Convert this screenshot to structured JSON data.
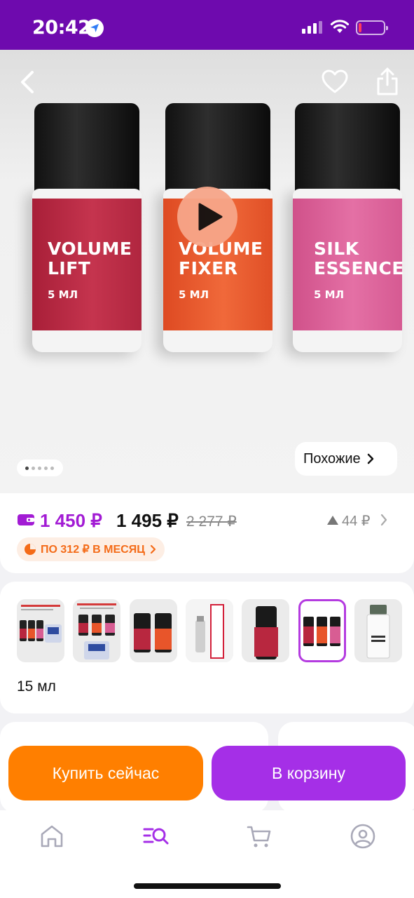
{
  "status_bar": {
    "time": "20:42",
    "battery_color": "#ff3b5c"
  },
  "hero": {
    "products": [
      {
        "line1": "VOLUME\nLIFT",
        "volume": "5 МЛ",
        "label_color": "#b8273f"
      },
      {
        "line1": "VOLUME\nFIXER",
        "volume": "5 МЛ",
        "label_color": "#e8552a"
      },
      {
        "line1": "SILK\nESSENCE",
        "volume": "5 МЛ",
        "label_color": "#d85d93"
      }
    ],
    "similar_label": "Похожие",
    "gallery_pages": 5,
    "gallery_active_index": 0
  },
  "price": {
    "wallet_price": "1 450 ₽",
    "price": "1 495 ₽",
    "old_price": "2 277 ₽",
    "rating_count": "44 ₽",
    "installment": "ПО 312 ₽ В МЕСЯЦ"
  },
  "variants": {
    "selected_index": 5,
    "selected_name": "15 мл",
    "items": [
      {
        "icon": "promo-set-thumb"
      },
      {
        "icon": "promo-set-thumb"
      },
      {
        "icon": "volume-lift-fixer-thumb"
      },
      {
        "icon": "sexy-glue-thumb"
      },
      {
        "icon": "volume-lift-thumb"
      },
      {
        "icon": "three-bottles-thumb"
      },
      {
        "icon": "eyelash-cleanser-thumb"
      }
    ]
  },
  "actions": {
    "buy_now": "Купить сейчас",
    "add_to_cart": "В корзину"
  },
  "colors": {
    "brand_purple": "#6e0aae",
    "accent_purple": "#a52fe7",
    "accent_orange": "#ff7f00"
  }
}
